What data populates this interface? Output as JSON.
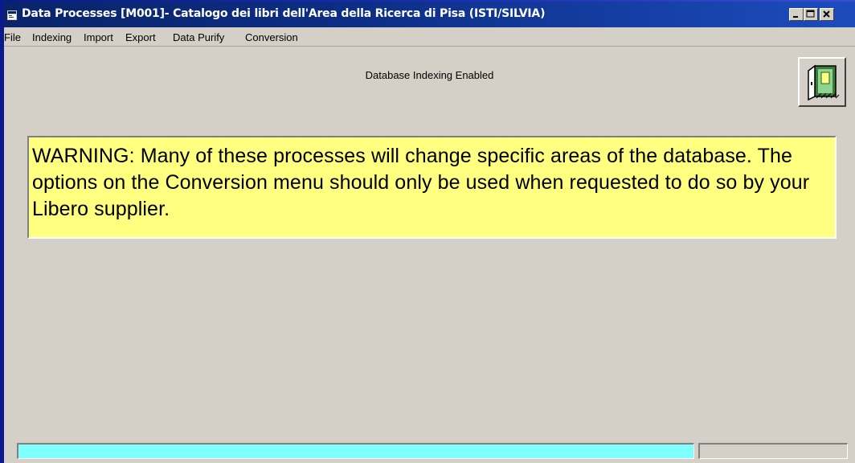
{
  "window": {
    "title": "Data Processes  [M001]- Catalogo dei libri dell'Area della Ricerca di Pisa  (ISTI/SILVIA)",
    "icon": "app-window-icon"
  },
  "title_buttons": {
    "minimize": "minimize-icon",
    "maximize": "maximize-icon",
    "close": "close-icon"
  },
  "menu": [
    {
      "label": "File"
    },
    {
      "label": "Indexing"
    },
    {
      "label": "Import"
    },
    {
      "label": "Export"
    },
    {
      "label": "Data Purify"
    },
    {
      "label": "Conversion"
    }
  ],
  "main": {
    "status_text": "Database Indexing Enabled",
    "exit_button_icon": "exit-door-icon",
    "warning_text": "WARNING:   Many of these processes will change specific areas of the database.  The options on the Conversion menu should only be used when requested to do so by your Libero supplier."
  },
  "colors": {
    "warning_background": "#ffff80",
    "progress_fill": "#80ffff",
    "titlebar": "#0a246a",
    "window_face": "#d4d0c8"
  }
}
